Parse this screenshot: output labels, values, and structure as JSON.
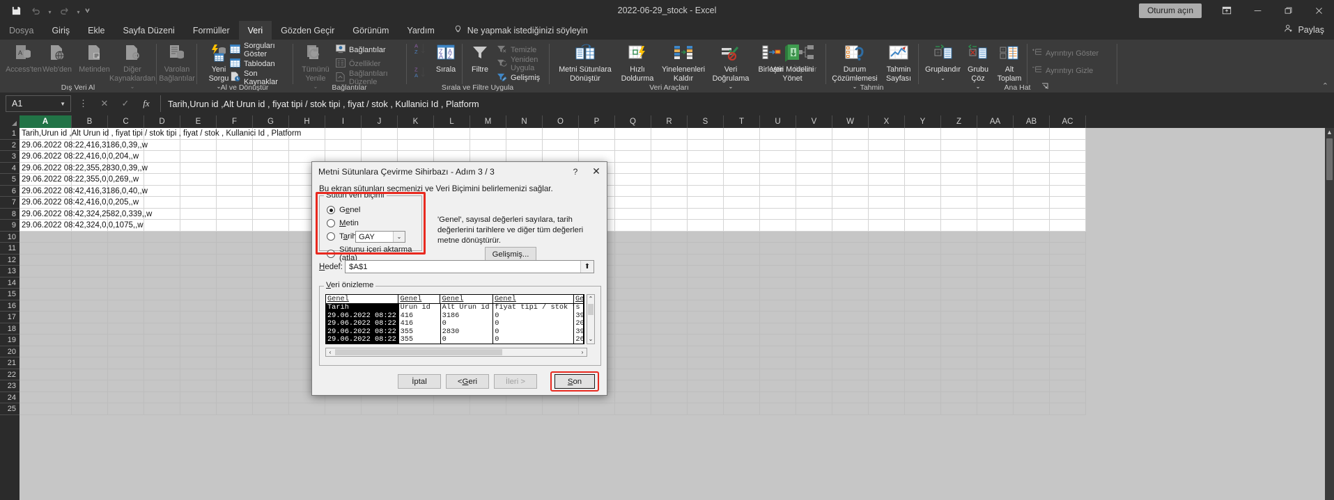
{
  "window": {
    "doc_title": "2022-06-29_stock  -  Excel",
    "sign_in": "Oturum açın",
    "share": "Paylaş",
    "quick_access": [
      "save-icon",
      "undo-icon",
      "redo-icon",
      "customize-icon"
    ],
    "ribbon_display_icon": "ribbon-display-options-icon",
    "minimize_icon": "minimize-icon",
    "restore_icon": "restore-icon",
    "close_icon": "close-icon"
  },
  "tabs": [
    {
      "label": "Dosya",
      "active": false
    },
    {
      "label": "Giriş",
      "active": false
    },
    {
      "label": "Ekle",
      "active": false
    },
    {
      "label": "Sayfa Düzeni",
      "active": false
    },
    {
      "label": "Formüller",
      "active": false
    },
    {
      "label": "Veri",
      "active": true
    },
    {
      "label": "Gözden Geçir",
      "active": false
    },
    {
      "label": "Görünüm",
      "active": false
    },
    {
      "label": "Yardım",
      "active": false
    }
  ],
  "tell_me": "Ne yapmak istediğinizi söyleyin",
  "ribbon": {
    "groups": [
      {
        "name": "Dış Veri Al",
        "big_buttons": [
          {
            "label": "Access'ten",
            "disabled": true
          },
          {
            "label": "Web'den",
            "disabled": true
          },
          {
            "label": "Metinden",
            "disabled": true
          },
          {
            "label": "Diğer\nKaynaklardan",
            "disabled": true
          },
          {
            "label": "Varolan\nBağlantılar",
            "disabled": true
          }
        ]
      },
      {
        "name": "Al ve Dönüştür",
        "big_buttons": [
          {
            "label": "Yeni\nSorgu",
            "disabled": false
          }
        ],
        "small_buttons": [
          {
            "label": "Sorguları Göster",
            "disabled": false
          },
          {
            "label": "Tablodan",
            "disabled": false
          },
          {
            "label": "Son Kaynaklar",
            "disabled": false
          }
        ]
      },
      {
        "name": "Bağlantılar",
        "big_buttons": [
          {
            "label": "Tümünü\nYenile",
            "disabled": true
          }
        ],
        "small_buttons": [
          {
            "label": "Bağlantılar",
            "disabled": false
          },
          {
            "label": "Özellikler",
            "disabled": true
          },
          {
            "label": "Bağlantıları Düzenle",
            "disabled": true
          }
        ]
      },
      {
        "name": "Sırala ve Filtre Uygula",
        "big_buttons": [
          {
            "label": "Sırala",
            "disabled": false
          },
          {
            "label": "Filtre",
            "disabled": false
          }
        ],
        "small_buttons": [
          {
            "label": "Temizle",
            "disabled": true
          },
          {
            "label": "Yeniden Uygula",
            "disabled": true
          },
          {
            "label": "Gelişmiş",
            "disabled": false
          }
        ],
        "mini_buttons": [
          {
            "label": "sort-ascending-icon"
          },
          {
            "label": "sort-descending-icon"
          }
        ]
      },
      {
        "name": "Veri Araçları",
        "big_buttons": [
          {
            "label": "Metni Sütunlara\nDönüştür",
            "disabled": false
          },
          {
            "label": "Hızlı\nDoldurma",
            "disabled": false
          },
          {
            "label": "Yinelenenleri\nKaldır",
            "disabled": false
          },
          {
            "label": "Veri\nDoğrulama",
            "disabled": false
          },
          {
            "label": "Birleştir",
            "disabled": false
          },
          {
            "label": "İlişkiler",
            "disabled": true
          },
          {
            "label": "Veri Modelini\nYönet",
            "disabled": false
          }
        ]
      },
      {
        "name": "Tahmin",
        "big_buttons": [
          {
            "label": "Durum\nÇözümlemesi",
            "disabled": false
          },
          {
            "label": "Tahmin\nSayfası",
            "disabled": false
          }
        ]
      },
      {
        "name": "Ana Hat",
        "big_buttons": [
          {
            "label": "Gruplandır",
            "disabled": false
          },
          {
            "label": "Grubu\nÇöz",
            "disabled": false
          },
          {
            "label": "Alt\nToplam",
            "disabled": false
          }
        ],
        "small_buttons": [
          {
            "label": "Ayrıntıyı Göster",
            "disabled": true
          },
          {
            "label": "Ayrıntıyı Gizle",
            "disabled": true
          }
        ]
      }
    ]
  },
  "formula_bar": {
    "name_box": "A1",
    "cancel_icon": "cancel-icon",
    "enter_icon": "confirm-icon",
    "function_icon": "insert-function-icon",
    "content": "Tarih,Urun id ,Alt Urun id , fiyat tipi / stok tipi , fiyat / stok , Kullanici Id , Platform"
  },
  "grid": {
    "columns": [
      "A",
      "B",
      "C",
      "D",
      "E",
      "F",
      "G",
      "H",
      "I",
      "J",
      "K",
      "L",
      "M",
      "N",
      "O",
      "P",
      "Q",
      "R",
      "S",
      "T",
      "U",
      "V",
      "W",
      "X",
      "Y",
      "Z",
      "AA",
      "AB",
      "AC"
    ],
    "selected_column": "A",
    "rows": [
      1,
      2,
      3,
      4,
      5,
      6,
      7,
      8,
      9,
      10,
      11,
      12,
      13,
      14,
      15,
      16,
      17,
      18,
      19,
      20,
      21,
      22,
      23,
      24,
      25
    ],
    "cell_values": [
      "Tarih,Urun id ,Alt Urun id , fiyat tipi / stok tipi , fiyat / stok , Kullanici Id , Platform",
      "29.06.2022 08:22,416,3186,0,39,,w",
      "29.06.2022 08:22,416,0,0,204,,w",
      "29.06.2022 08:22,355,2830,0,39,,w",
      "29.06.2022 08:22,355,0,0,269,,w",
      "29.06.2022 08:42,416,3186,0,40,,w",
      "29.06.2022 08:42,416,0,0,205,,w",
      "29.06.2022 08:42,324,2582,0,339,,w",
      "29.06.2022 08:42,324,0,0,1075,,w"
    ]
  },
  "dialog": {
    "title": "Metni Sütunlara Çevirme Sihirbazı - Adım 3 / 3",
    "help_icon": "help-icon",
    "close_icon": "close-icon",
    "subtitle": "Bu ekran sütunları seçmenizi ve Veri Biçimini belirlemenizi  sağlar.",
    "fieldset_legend": "Sütun veri biçimi",
    "radios": [
      {
        "label": "Genel",
        "underline_index": 2,
        "selected": true
      },
      {
        "label": "Metin",
        "underline_index": 0,
        "selected": false
      },
      {
        "label": "Tarih:",
        "underline_index": 1,
        "selected": false
      },
      {
        "label": "Sütunu içeri aktarma (atla)",
        "underline_index": 4,
        "selected": false
      }
    ],
    "date_format": "GAY",
    "description": "'Genel', sayısal değerleri sayılara, tarih değerlerini tarihlere ve diğer tüm değerleri metne dönüştürür.",
    "advanced_button": "Gelişmiş...",
    "destination_label": "Hedef:",
    "destination_value": "$A$1",
    "destination_picker_icon": "collapse-dialog-icon",
    "preview_legend": "Veri önizleme",
    "preview": {
      "format_headers": [
        "Genel",
        "Genel",
        "Genel",
        "Genel",
        "Ge"
      ],
      "rows": [
        [
          "Tarih",
          "Urun id",
          "Alt Urun id",
          " fiyat tipi / stok tipi",
          " s"
        ],
        [
          "29.06.2022 08:22",
          "416",
          "3186",
          "0",
          "39"
        ],
        [
          "29.06.2022 08:22",
          "416",
          "0",
          "0",
          "20"
        ],
        [
          "29.06.2022 08:22",
          "355",
          "2830",
          "0",
          "39"
        ],
        [
          "29.06.2022 08:22",
          "355",
          "0",
          "0",
          "26"
        ]
      ],
      "highlighted_column": 0
    },
    "buttons": [
      {
        "label": "İptal",
        "disabled": false,
        "highlighted": false
      },
      {
        "label": "< Geri",
        "disabled": false,
        "highlighted": false
      },
      {
        "label": "İleri >",
        "disabled": true,
        "highlighted": false
      },
      {
        "label": "Son",
        "disabled": false,
        "highlighted": true
      }
    ],
    "highlight_color": "#e8291f"
  }
}
